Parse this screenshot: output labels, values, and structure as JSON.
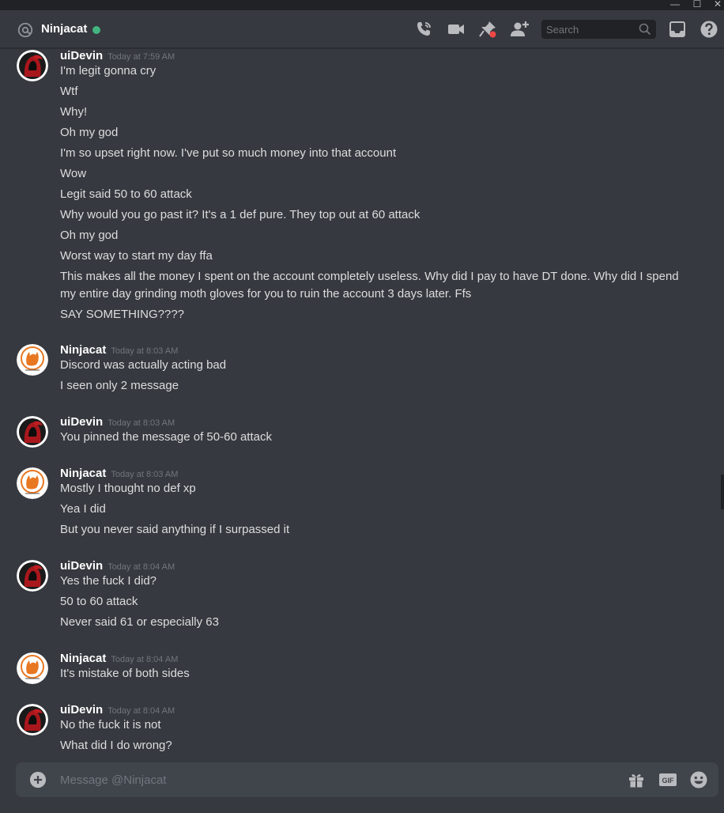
{
  "window": {
    "minimize": "—",
    "maximize": "☐",
    "close": "✕"
  },
  "header": {
    "channel_name": "Ninjacat",
    "search_placeholder": "Search",
    "icons": [
      "call-icon",
      "video-icon",
      "pin-icon",
      "add-friend-icon",
      "search-icon",
      "inbox-icon",
      "help-icon"
    ],
    "status_color": "#43b581"
  },
  "messages": [
    {
      "author": "uiDevin",
      "timestamp": "Today at 7:59 AM",
      "avatar": "red-hooded-figure",
      "lines": [
        "I'm legit gonna cry",
        "Wtf",
        "Why!",
        "Oh my god",
        "I'm so upset right now. I've put so much money into that account",
        "Wow",
        "Legit said 50 to 60 attack",
        "Why would you go past it? It's a 1 def pure. They top out at 60 attack",
        "Oh my god",
        "Worst way to start my day ffa",
        "This makes all the money I spent on the account completely useless. Why did I pay to have DT done. Why did I spend",
        "my entire day grinding moth gloves for you to ruin the account 3 days later. Ffs",
        "SAY SOMETHING????"
      ]
    },
    {
      "author": "Ninjacat",
      "timestamp": "Today at 8:03 AM",
      "avatar": "orange-cat-logo",
      "lines": [
        "Discord was actually acting bad",
        "I seen only 2 message"
      ]
    },
    {
      "author": "uiDevin",
      "timestamp": "Today at 8:03 AM",
      "avatar": "red-hooded-figure",
      "lines": [
        "You pinned the message of 50-60 attack"
      ]
    },
    {
      "author": "Ninjacat",
      "timestamp": "Today at 8:03 AM",
      "avatar": "orange-cat-logo",
      "lines": [
        "Mostly I thought no def xp",
        "Yea I did",
        "But you never said anything if I surpassed it"
      ]
    },
    {
      "author": "uiDevin",
      "timestamp": "Today at 8:04 AM",
      "avatar": "red-hooded-figure",
      "lines": [
        "Yes the fuck I did?",
        "50 to 60 attack",
        "Never said 61 or especially 63"
      ]
    },
    {
      "author": "Ninjacat",
      "timestamp": "Today at 8:04 AM",
      "avatar": "orange-cat-logo",
      "lines": [
        "It's mistake of both sides"
      ]
    },
    {
      "author": "uiDevin",
      "timestamp": "Today at 8:04 AM",
      "avatar": "red-hooded-figure",
      "lines": [
        "No the fuck it is not",
        "What did I do wrong?"
      ]
    }
  ],
  "composer": {
    "placeholder": "Message @Ninjacat",
    "gif_label": "GIF",
    "icons": [
      "add-attachment-icon",
      "gift-icon",
      "gif-icon",
      "emoji-icon"
    ]
  }
}
